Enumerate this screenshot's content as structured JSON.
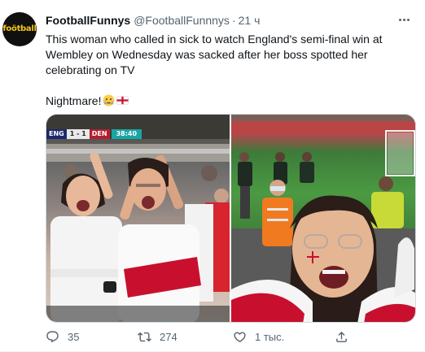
{
  "author": {
    "display_name": "FootballFunnys",
    "handle": "@FootballFunnnys",
    "separator": "·",
    "time": "21 ч",
    "avatar_text": "foötball",
    "avatar_icon": "football-funnys-logo"
  },
  "tweet": {
    "text_line1": "This woman who called in sick to watch England's semi-final win at Wembley on Wednesday was sacked after her boss spotted her celebrating on TV",
    "text_line2": "Nightmare!",
    "emojis": [
      "crying-face-emoji",
      "england-flag-emoji"
    ]
  },
  "media": {
    "scorebug": {
      "team_home": "ENG",
      "score": "1 - 1",
      "team_away": "DEN",
      "clock": "38:40"
    },
    "colors": {
      "england_red": "#c8102e",
      "pitch_green": "#4b9a42",
      "steward_orange": "#f07a20"
    }
  },
  "actions": {
    "reply_count": "35",
    "retweet_count": "274",
    "like_count": "1 тыс.",
    "icons": [
      "reply-icon",
      "retweet-icon",
      "like-icon",
      "share-icon"
    ]
  },
  "colors": {
    "text_primary": "#0f1419",
    "text_secondary": "#536471",
    "border": "#cfd9de"
  }
}
